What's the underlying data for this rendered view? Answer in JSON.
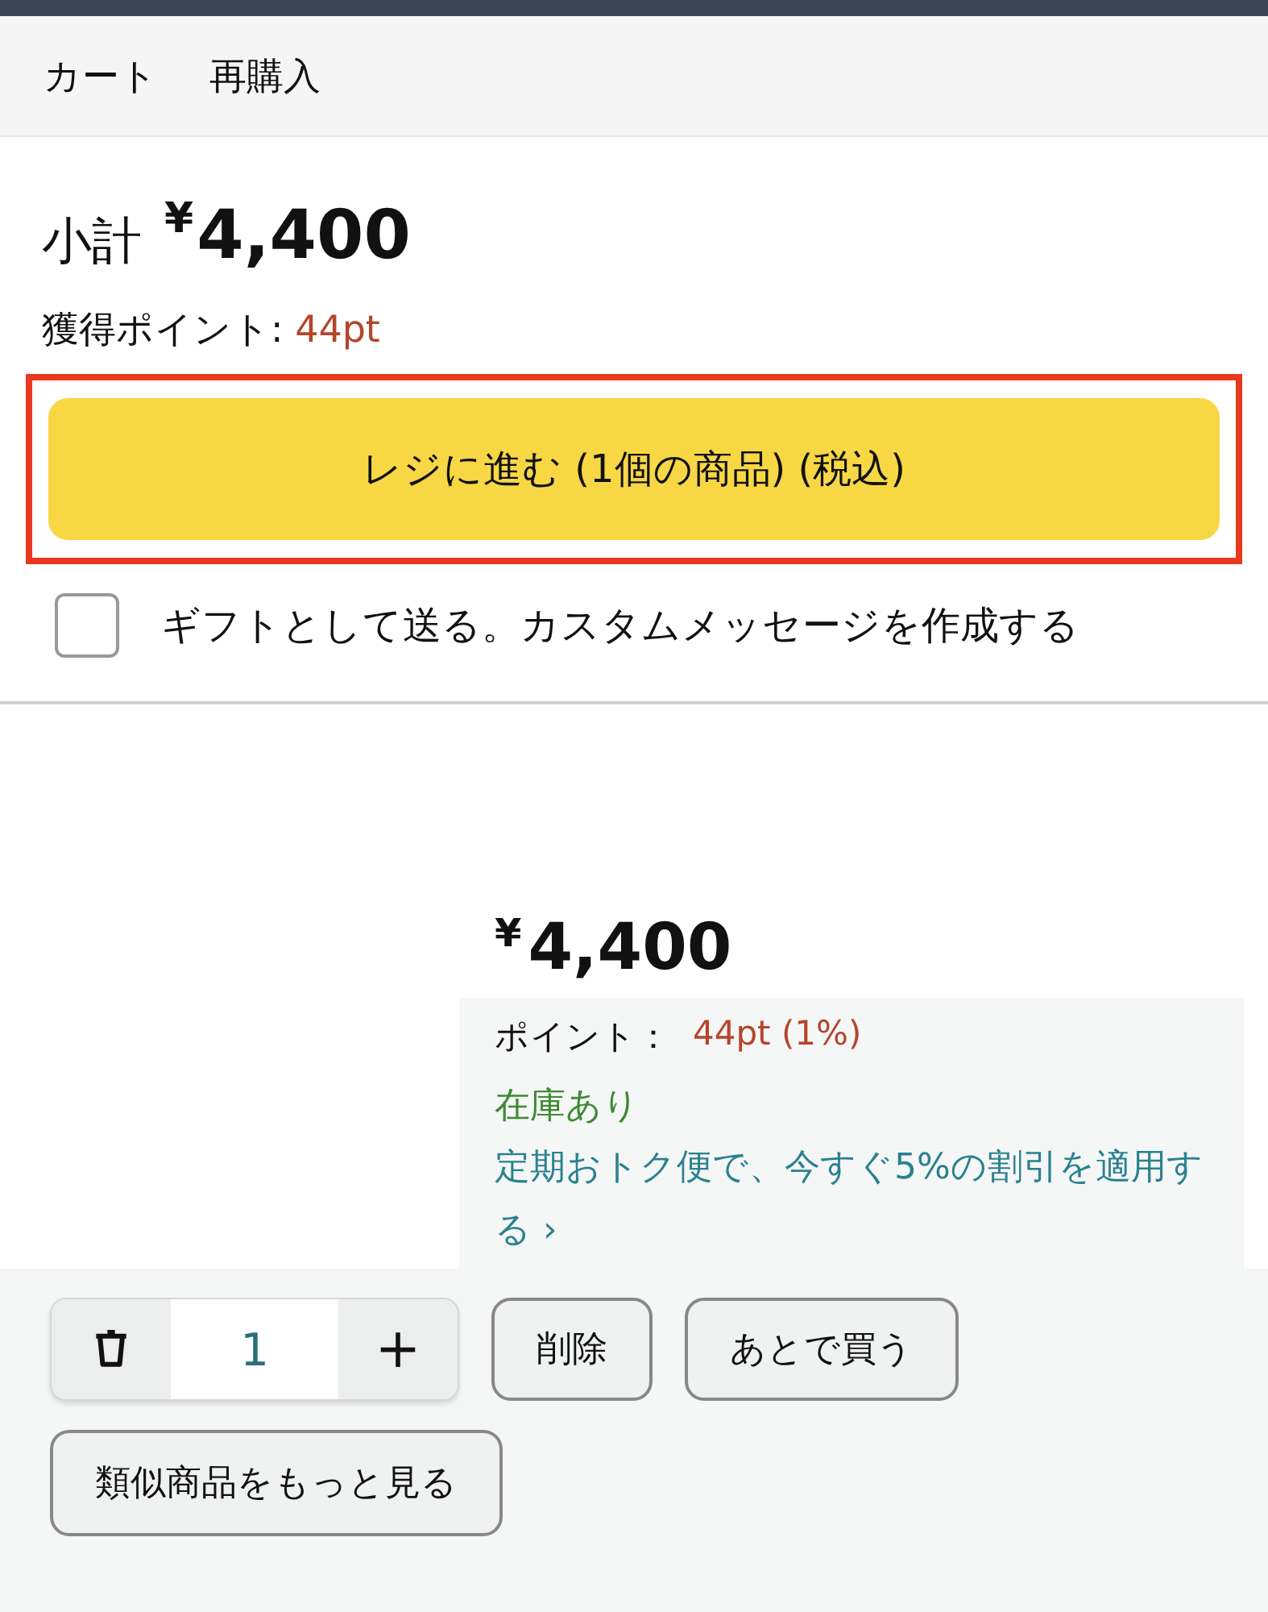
{
  "nav_tabs": [
    {
      "label": "カート"
    },
    {
      "label": "再購入"
    }
  ],
  "subtotal": {
    "label": "小計",
    "currency": "¥",
    "amount": "4,400",
    "points_label": "獲得ポイント: ",
    "points": "44pt"
  },
  "checkout_button": {
    "label": "レジに進む (1個の商品) (税込)",
    "highlighted": true
  },
  "gift_option": {
    "label": "ギフトとして送る。カスタムメッセージを作成する",
    "checked": false
  },
  "item": {
    "currency": "¥",
    "price": "4,400",
    "points_label": "ポイント：",
    "points": "44pt (1%)",
    "stock": "在庫あり",
    "subscribe_link": "定期おトク便で、今すぐ5%の割引を適用する",
    "subscribe_arrow": "›",
    "quantity": "1",
    "plus": "+",
    "buttons": [
      {
        "label": "削除"
      },
      {
        "label": "あとで買う"
      }
    ],
    "similar_button": "類似商品をもっと見る"
  }
}
